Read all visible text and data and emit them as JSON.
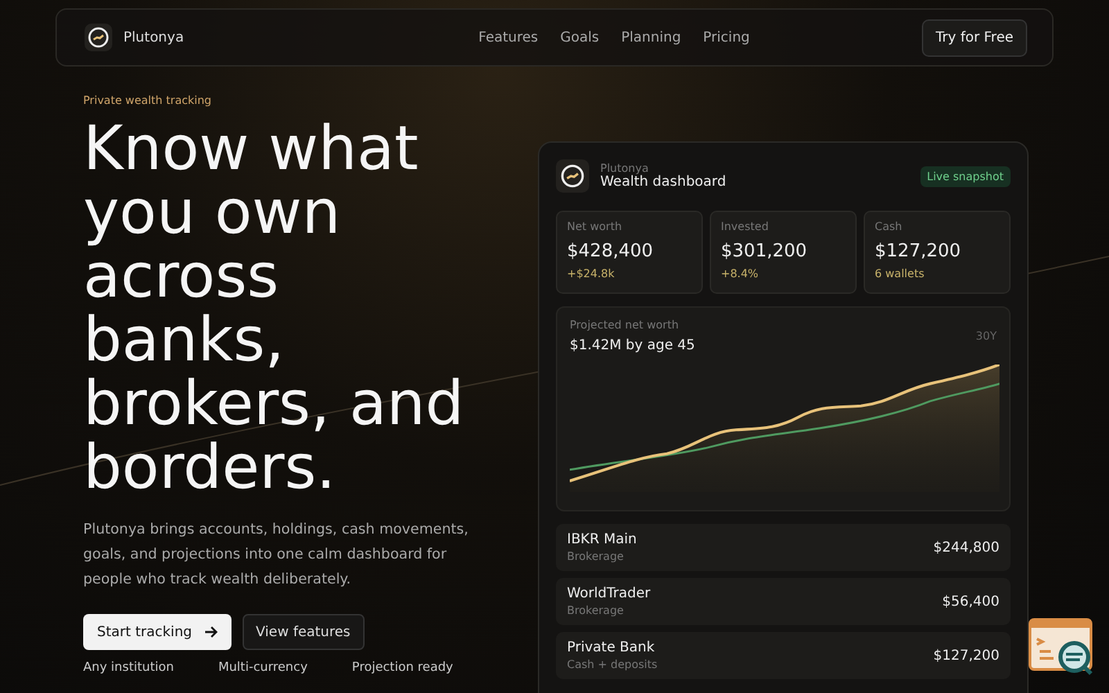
{
  "nav": {
    "brand": "Plutonya",
    "links": [
      "Features",
      "Goals",
      "Planning",
      "Pricing"
    ],
    "cta": "Try for Free"
  },
  "hero": {
    "eyebrow": "Private wealth tracking",
    "headline": "Know what you own across banks, brokers, and borders.",
    "body": "Plutonya brings accounts, holdings, cash movements, goals, and projections into one calm dashboard for people who track wealth deliberately.",
    "primary_button": "Start tracking",
    "secondary_button": "View features",
    "features": [
      "Any institution",
      "Multi-currency",
      "Projection ready"
    ]
  },
  "dashboard": {
    "brand": "Plutonya",
    "title": "Wealth dashboard",
    "badge": "Live snapshot",
    "stats": [
      {
        "label": "Net worth",
        "value": "$428,400",
        "delta": "+$24.8k"
      },
      {
        "label": "Invested",
        "value": "$301,200",
        "delta": "+8.4%"
      },
      {
        "label": "Cash",
        "value": "$127,200",
        "delta": "6 wallets"
      }
    ],
    "projection": {
      "label": "Projected net worth",
      "value": "$1.42M by age 45",
      "range": "30Y"
    },
    "accounts": [
      {
        "name": "IBKR Main",
        "type": "Brokerage",
        "amount": "$244,800"
      },
      {
        "name": "WorldTrader",
        "type": "Brokerage",
        "amount": "$56,400"
      },
      {
        "name": "Private Bank",
        "type": "Cash + deposits",
        "amount": "$127,200"
      }
    ]
  }
}
